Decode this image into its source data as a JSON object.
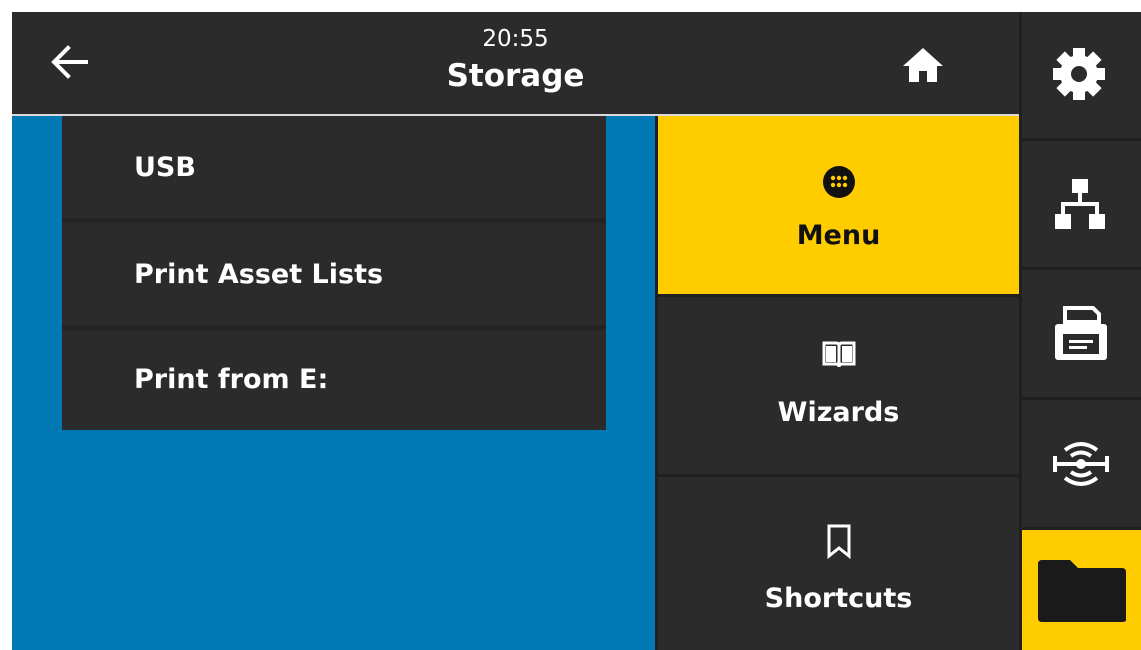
{
  "header": {
    "time": "20:55",
    "title": "Storage",
    "back_icon": "arrow-left-icon",
    "home_icon": "home-icon"
  },
  "list": {
    "items": [
      {
        "label": "USB"
      },
      {
        "label": "Print Asset Lists"
      },
      {
        "label": "Print from E:"
      }
    ]
  },
  "menu": {
    "items": [
      {
        "label": "Menu",
        "icon": "dots-grid-icon",
        "selected": true
      },
      {
        "label": "Wizards",
        "icon": "book-icon",
        "selected": false
      },
      {
        "label": "Shortcuts",
        "icon": "bookmark-icon",
        "selected": false
      }
    ]
  },
  "sidebar": {
    "items": [
      {
        "icon": "gear-icon",
        "selected": false
      },
      {
        "icon": "network-icon",
        "selected": false
      },
      {
        "icon": "printer-icon",
        "selected": false
      },
      {
        "icon": "rfid-icon",
        "selected": false
      },
      {
        "icon": "folder-icon",
        "selected": true
      }
    ]
  },
  "colors": {
    "accent": "#ffcc00",
    "content_bg": "#0079b4",
    "panel": "#2b2b2b",
    "background": "#1f1f1f",
    "text": "#ffffff"
  }
}
